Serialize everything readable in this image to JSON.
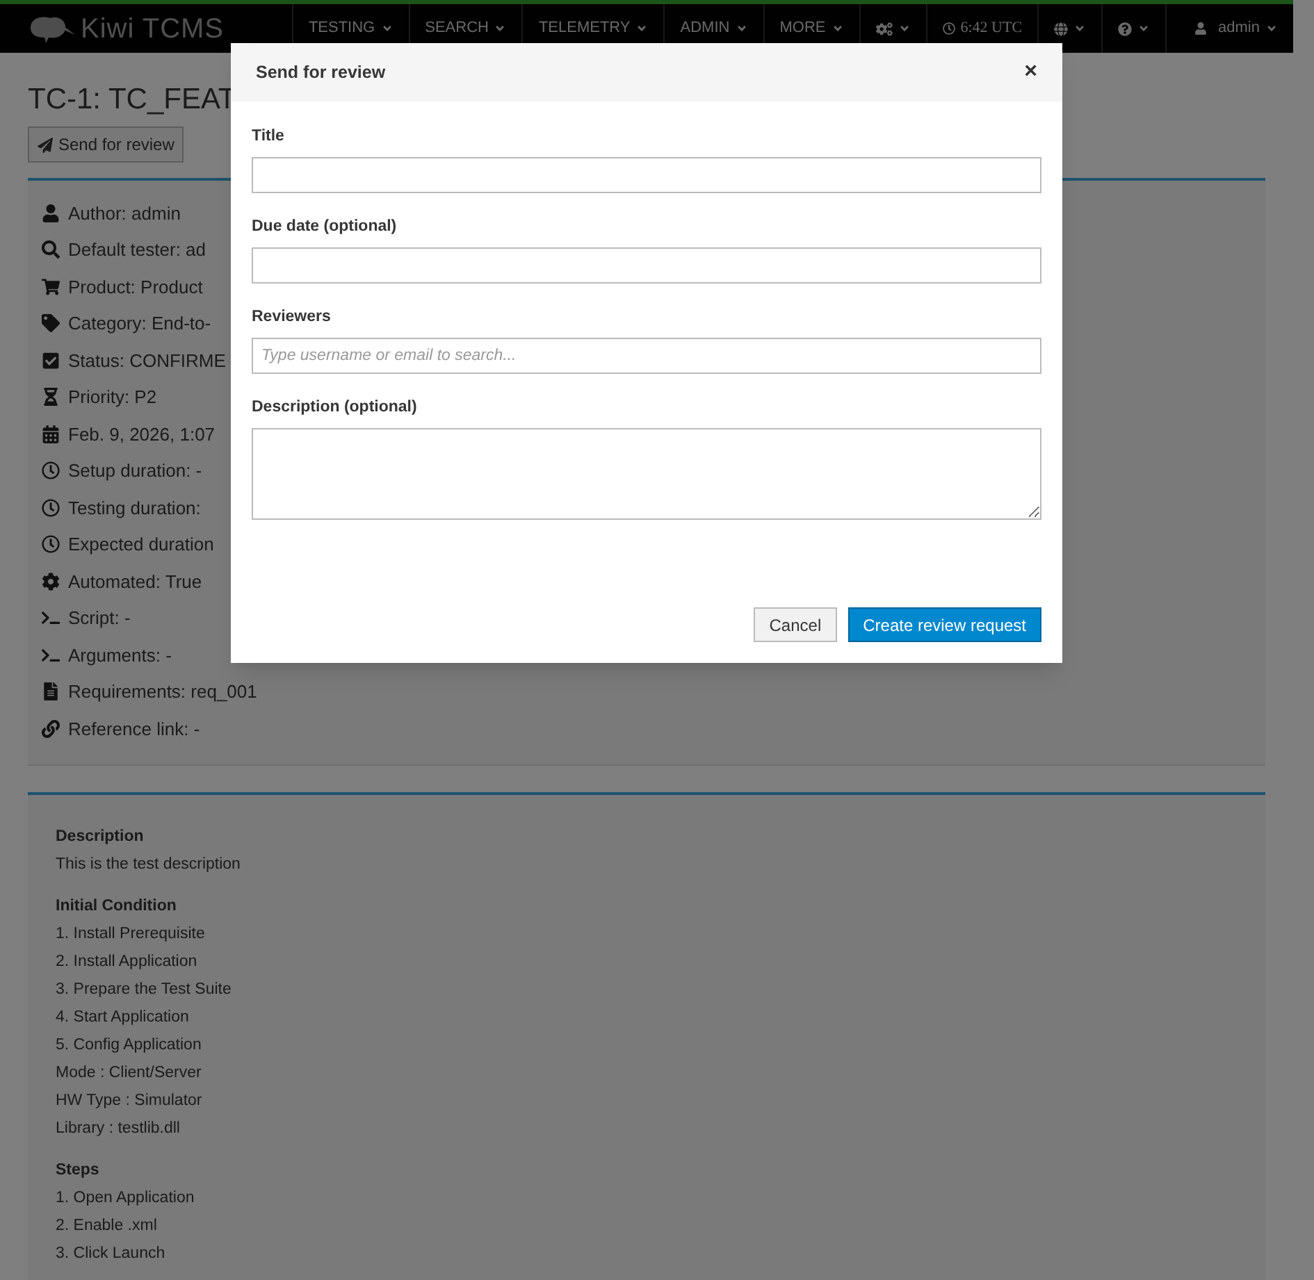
{
  "navbar": {
    "brand": "Kiwi TCMS",
    "menus": [
      {
        "label": "TESTING"
      },
      {
        "label": "SEARCH"
      },
      {
        "label": "TELEMETRY"
      },
      {
        "label": "ADMIN"
      },
      {
        "label": "MORE"
      }
    ],
    "time": "6:42 UTC",
    "user": "admin"
  },
  "page": {
    "title": "TC-1: TC_FEAT",
    "action": "Send for review"
  },
  "properties": [
    "Author: admin",
    "Default tester: ad",
    "Product: Product",
    "Category: End-to-",
    "Status: CONFIRME",
    "Priority: P2",
    "Feb. 9, 2026, 1:07",
    "Setup duration: -",
    "Testing duration:",
    "Expected duration",
    "Automated: True",
    "Script: -",
    "Arguments: -",
    "Requirements: req_001",
    "Reference link: -"
  ],
  "sections": [
    {
      "heading": "Description",
      "lines": [
        "This is the test description"
      ]
    },
    {
      "heading": "Initial Condition",
      "lines": [
        "1. Install Prerequisite",
        "2. Install Application",
        "3. Prepare the Test Suite",
        "4. Start Application",
        "5. Config Application",
        "Mode : Client/Server",
        "HW Type : Simulator",
        "Library : testlib.dll"
      ]
    },
    {
      "heading": "Steps",
      "lines": [
        "1. Open Application",
        "2. Enable .xml",
        "3. Click Launch"
      ]
    }
  ],
  "dialog": {
    "title": "Send for review",
    "close": "×",
    "fields": [
      {
        "kind": "input",
        "label": "Title"
      },
      {
        "kind": "input",
        "label": "Due date (optional)"
      },
      {
        "kind": "input",
        "label": "Reviewers",
        "placeholder": "Type username or email to search..."
      },
      {
        "kind": "textarea",
        "label": "Description (optional)"
      }
    ],
    "buttons": [
      {
        "kind": "default",
        "label": "Cancel"
      },
      {
        "kind": "primary",
        "label": "Create review request"
      }
    ]
  }
}
